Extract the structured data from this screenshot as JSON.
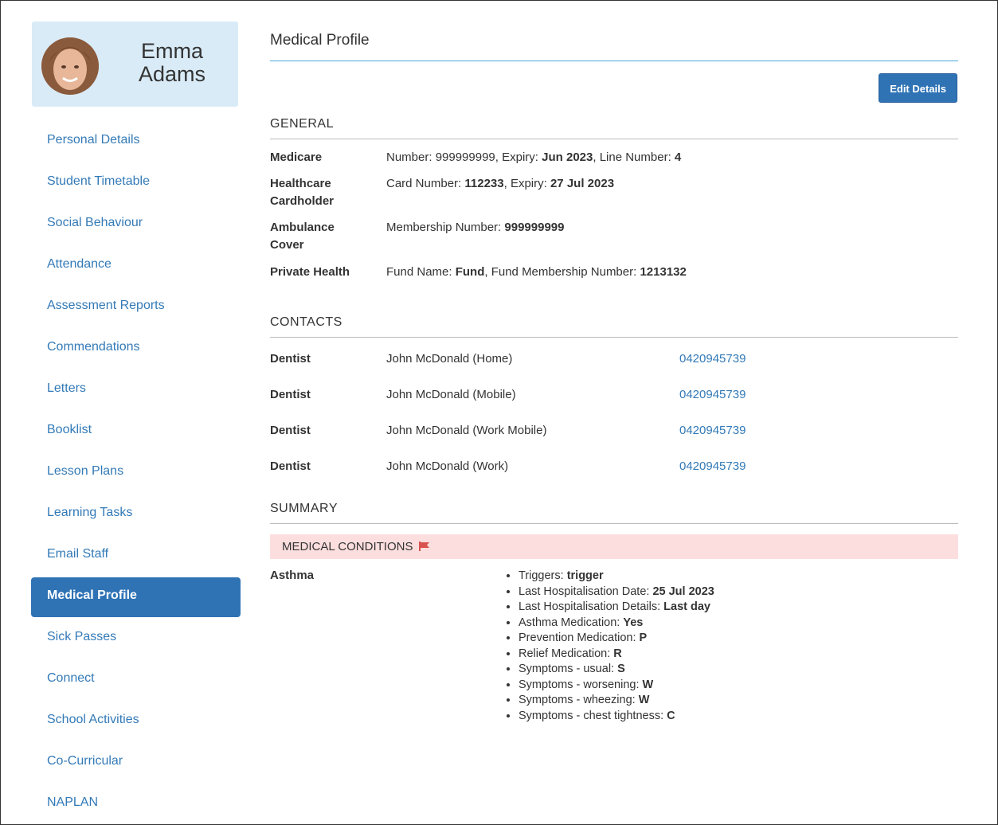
{
  "student": {
    "first_name": "Emma",
    "last_name": "Adams"
  },
  "sidebar": {
    "items": [
      {
        "label": "Personal Details",
        "active": false
      },
      {
        "label": "Student Timetable",
        "active": false
      },
      {
        "label": "Social Behaviour",
        "active": false
      },
      {
        "label": "Attendance",
        "active": false
      },
      {
        "label": "Assessment Reports",
        "active": false
      },
      {
        "label": "Commendations",
        "active": false
      },
      {
        "label": "Letters",
        "active": false
      },
      {
        "label": "Booklist",
        "active": false
      },
      {
        "label": "Lesson Plans",
        "active": false
      },
      {
        "label": "Learning Tasks",
        "active": false
      },
      {
        "label": "Email Staff",
        "active": false
      },
      {
        "label": "Medical Profile",
        "active": true
      },
      {
        "label": "Sick Passes",
        "active": false
      },
      {
        "label": "Connect",
        "active": false
      },
      {
        "label": "School Activities",
        "active": false
      },
      {
        "label": "Co-Curricular",
        "active": false
      },
      {
        "label": "NAPLAN",
        "active": false
      }
    ]
  },
  "main": {
    "title": "Medical Profile",
    "edit_label": "Edit Details",
    "general": {
      "heading": "GENERAL",
      "medicare": {
        "label": "Medicare",
        "number_label": "Number: ",
        "number": "999999999",
        "expiry_label": ", Expiry: ",
        "expiry": "Jun 2023",
        "line_label": ", Line Number: ",
        "line": "4"
      },
      "healthcare": {
        "label_1": "Healthcare",
        "label_2": "Cardholder",
        "card_label": "Card Number: ",
        "card": "112233",
        "expiry_label": ", Expiry: ",
        "expiry": "27 Jul 2023"
      },
      "ambulance": {
        "label_1": "Ambulance",
        "label_2": "Cover",
        "membership_label": "Membership Number: ",
        "membership": "999999999"
      },
      "private_health": {
        "label": "Private Health",
        "fund_label": "Fund Name: ",
        "fund": "Fund",
        "membership_label": ", Fund Membership Number: ",
        "membership": "1213132"
      }
    },
    "contacts": {
      "heading": "CONTACTS",
      "rows": [
        {
          "type": "Dentist",
          "name": "John McDonald (Home)",
          "phone": "0420945739"
        },
        {
          "type": "Dentist",
          "name": "John McDonald (Mobile)",
          "phone": "0420945739"
        },
        {
          "type": "Dentist",
          "name": "John McDonald (Work Mobile)",
          "phone": "0420945739"
        },
        {
          "type": "Dentist",
          "name": "John McDonald (Work)",
          "phone": "0420945739"
        }
      ]
    },
    "summary": {
      "heading": "SUMMARY",
      "banner": "MEDICAL CONDITIONS",
      "condition": "Asthma",
      "details": [
        {
          "label": "Triggers: ",
          "value": "trigger"
        },
        {
          "label": "Last Hospitalisation Date: ",
          "value": "25 Jul 2023"
        },
        {
          "label": "Last Hospitalisation Details: ",
          "value": "Last day"
        },
        {
          "label": "Asthma Medication: ",
          "value": "Yes"
        },
        {
          "label": "Prevention Medication: ",
          "value": "P"
        },
        {
          "label": "Relief Medication: ",
          "value": "R"
        },
        {
          "label": "Symptoms - usual: ",
          "value": "S"
        },
        {
          "label": "Symptoms - worsening: ",
          "value": "W"
        },
        {
          "label": "Symptoms - wheezing: ",
          "value": "W"
        },
        {
          "label": "Symptoms - chest tightness: ",
          "value": "C"
        }
      ]
    }
  },
  "colors": {
    "accent": "#2f73b5",
    "link": "#337ab7",
    "profile_bg": "#d9ebf7",
    "alert_bg": "#fcdede",
    "flag": "#d9534f"
  }
}
